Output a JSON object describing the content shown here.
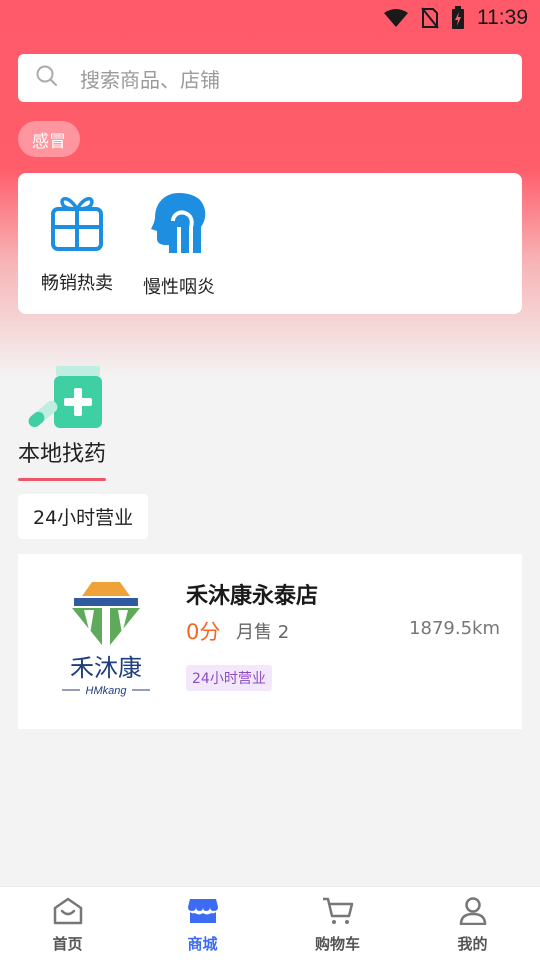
{
  "status_bar": {
    "time": "11:39"
  },
  "search": {
    "placeholder": "搜索商品、店铺"
  },
  "hot_tag": {
    "label": "感冒"
  },
  "categories": [
    {
      "label": "畅销热卖",
      "icon": "gift-icon"
    },
    {
      "label": "慢性咽炎",
      "icon": "throat-icon"
    }
  ],
  "local_section": {
    "title": "本地找药",
    "icon": "medicine-bottle-icon"
  },
  "filter": {
    "label": "24小时营业"
  },
  "store": {
    "name": "禾沐康永泰店",
    "score": "0分",
    "sales": "月售 2",
    "distance": "1879.5km",
    "badge": "24小时营业",
    "logo_text": "禾沐康",
    "logo_subtext": "HMkang"
  },
  "tabbar": {
    "items": [
      {
        "label": "首页",
        "icon": "home-icon",
        "active": false
      },
      {
        "label": "商城",
        "icon": "store-icon",
        "active": true
      },
      {
        "label": "购物车",
        "icon": "cart-icon",
        "active": false
      },
      {
        "label": "我的",
        "icon": "user-icon",
        "active": false
      }
    ]
  },
  "colors": {
    "accent": "#ff5a6a",
    "active_tab": "#3d6bf2",
    "score": "#f5651f",
    "icon_blue": "#1e8fe0"
  }
}
